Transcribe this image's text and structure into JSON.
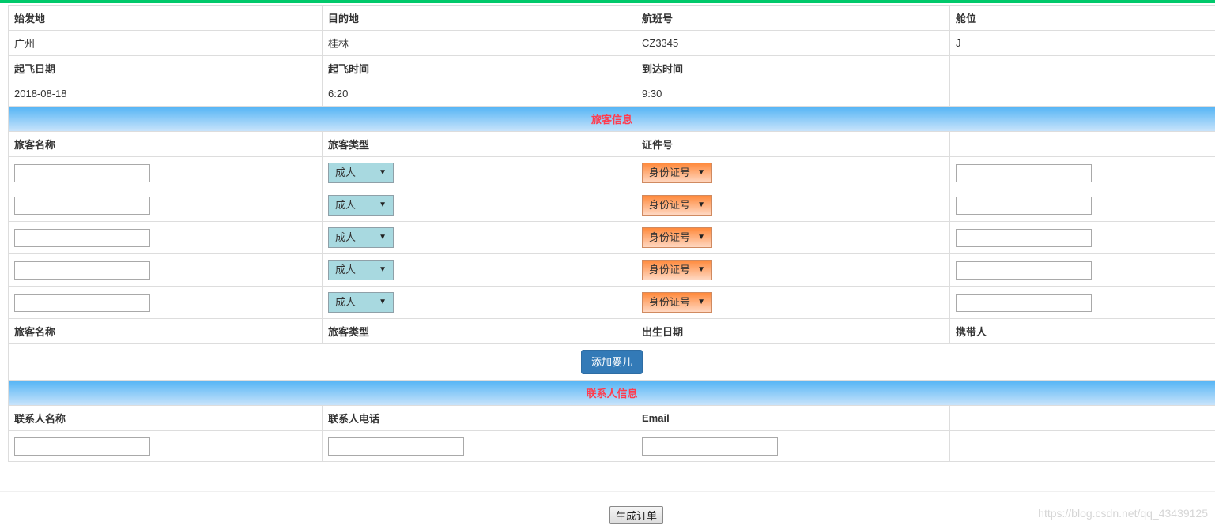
{
  "flight": {
    "headers": [
      "始发地",
      "目的地",
      "航班号",
      "舱位"
    ],
    "values": [
      "广州",
      "桂林",
      "CZ3345",
      "J"
    ],
    "headers2": [
      "起飞日期",
      "起飞时间",
      "到达时间",
      ""
    ],
    "values2": [
      "2018-08-18",
      "6:20",
      "9:30",
      ""
    ]
  },
  "passenger": {
    "section_title": "旅客信息",
    "headers": [
      "旅客名称",
      "旅客类型",
      "证件号",
      ""
    ],
    "rows": [
      {
        "name": "",
        "type": "成人",
        "id_type": "身份证号",
        "id_number": ""
      },
      {
        "name": "",
        "type": "成人",
        "id_type": "身份证号",
        "id_number": ""
      },
      {
        "name": "",
        "type": "成人",
        "id_type": "身份证号",
        "id_number": ""
      },
      {
        "name": "",
        "type": "成人",
        "id_type": "身份证号",
        "id_number": ""
      },
      {
        "name": "",
        "type": "成人",
        "id_type": "身份证号",
        "id_number": ""
      }
    ]
  },
  "infant": {
    "headers": [
      "旅客名称",
      "旅客类型",
      "出生日期",
      "携带人"
    ],
    "add_button": "添加婴儿"
  },
  "contact": {
    "section_title": "联系人信息",
    "headers": [
      "联系人名称",
      "联系人电话",
      "Email",
      ""
    ],
    "values": {
      "name": "",
      "phone": "",
      "email": ""
    }
  },
  "submit_label": "生成订单",
  "watermark": "https://blog.csdn.net/qq_43439125",
  "colors": {
    "top_bar": "#00c96b",
    "section_text": "#ff3b4e",
    "primary_button": "#337ab7",
    "type_select": "#a8d9e0",
    "id_select": "#ff8a3c"
  }
}
